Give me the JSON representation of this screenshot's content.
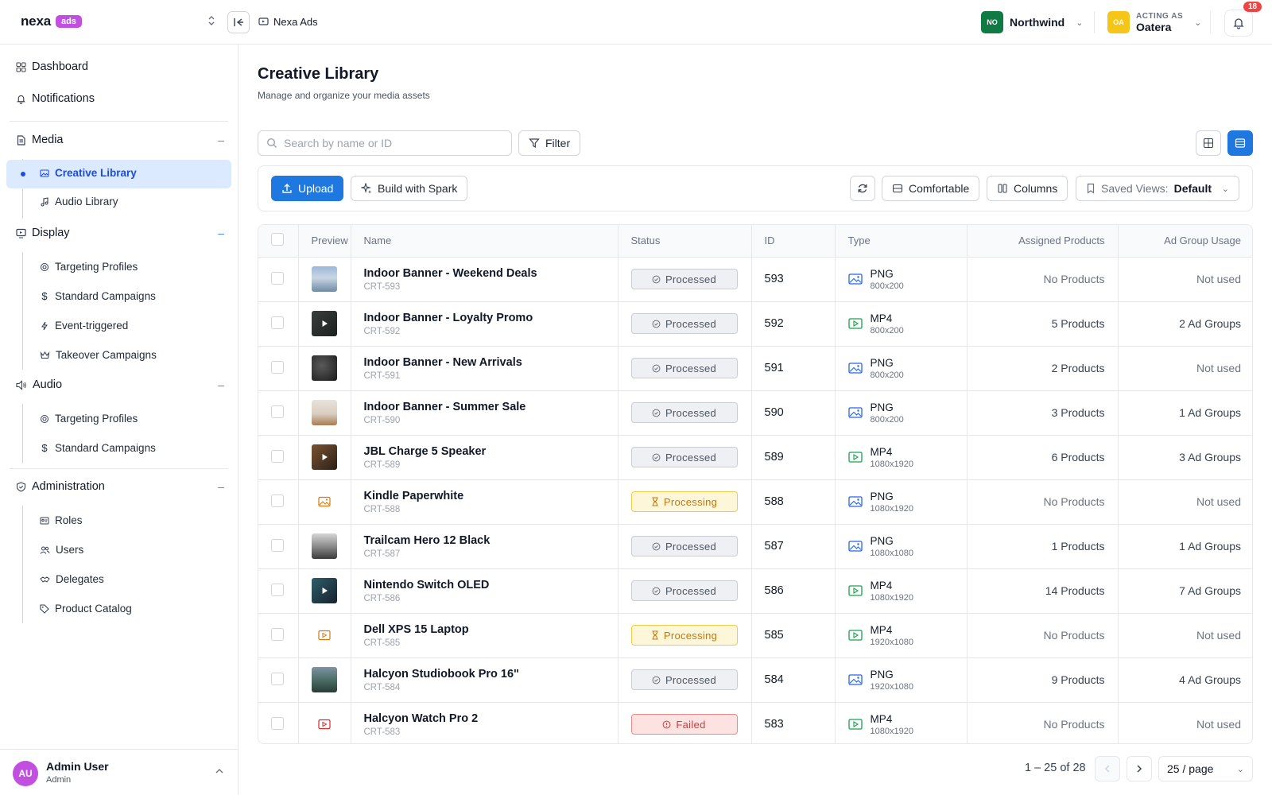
{
  "header": {
    "brand_name": "nexa",
    "brand_badge": "ads",
    "breadcrumb": "Nexa Ads",
    "org": {
      "initials": "NO",
      "name": "Northwind",
      "color": "#0f7a43"
    },
    "acting_as": {
      "label": "ACTING AS",
      "initials": "OA",
      "name": "Oatera",
      "color": "#f5c518"
    },
    "notifications_count": "18"
  },
  "sidebar": {
    "top_items": [
      {
        "label": "Dashboard",
        "icon": "grid-icon"
      },
      {
        "label": "Notifications",
        "icon": "bell-icon"
      }
    ],
    "sections": [
      {
        "label": "Media",
        "icon": "document-icon",
        "collapse": "–",
        "items": [
          {
            "label": "Creative Library",
            "icon": "image-icon",
            "active": true
          },
          {
            "label": "Audio Library",
            "icon": "music-note-icon"
          }
        ]
      },
      {
        "label": "Display",
        "icon": "monitor-icon",
        "collapse": "–",
        "items": [
          {
            "label": "Targeting Profiles",
            "icon": "target-icon"
          },
          {
            "label": "Standard Campaigns",
            "icon": "dollar-icon"
          },
          {
            "label": "Event-triggered",
            "icon": "lightning-icon"
          },
          {
            "label": "Takeover Campaigns",
            "icon": "crown-icon"
          }
        ]
      },
      {
        "label": "Audio",
        "icon": "speaker-icon",
        "collapse": "–",
        "items": [
          {
            "label": "Targeting Profiles",
            "icon": "target-icon"
          },
          {
            "label": "Standard Campaigns",
            "icon": "dollar-icon"
          }
        ]
      },
      {
        "label": "Administration",
        "icon": "shield-check-icon",
        "collapse": "–",
        "items": [
          {
            "label": "Roles",
            "icon": "id-card-icon"
          },
          {
            "label": "Users",
            "icon": "users-icon"
          },
          {
            "label": "Delegates",
            "icon": "handshake-icon"
          },
          {
            "label": "Product Catalog",
            "icon": "tag-icon"
          }
        ]
      }
    ],
    "user": {
      "initials": "AU",
      "name": "Admin User",
      "role": "Admin"
    }
  },
  "main": {
    "title": "Creative Library",
    "subtitle": "Manage and organize your media assets",
    "search_placeholder": "Search by name or ID",
    "filter_label": "Filter",
    "upload_label": "Upload",
    "spark_label": "Build with Spark",
    "density_label": "Comfortable",
    "columns_label": "Columns",
    "saved_views_label": "Saved Views:",
    "saved_views_value": "Default"
  },
  "table": {
    "columns": [
      "Preview",
      "Name",
      "Status",
      "ID",
      "Type",
      "Assigned Products",
      "Ad Group Usage"
    ],
    "rows": [
      {
        "name": "Indoor Banner - Weekend Deals",
        "code": "CRT-593",
        "status": "Processed",
        "id": "593",
        "type": "PNG",
        "dims": "800x200",
        "products": "No Products",
        "usage": "Not used",
        "thumb": "landscape"
      },
      {
        "name": "Indoor Banner - Loyalty Promo",
        "code": "CRT-592",
        "status": "Processed",
        "id": "592",
        "type": "MP4",
        "dims": "800x200",
        "products": "5 Products",
        "usage": "2 Ad Groups",
        "thumb": "video-dark"
      },
      {
        "name": "Indoor Banner - New Arrivals",
        "code": "CRT-591",
        "status": "Processed",
        "id": "591",
        "type": "PNG",
        "dims": "800x200",
        "products": "2 Products",
        "usage": "Not used",
        "thumb": "dark"
      },
      {
        "name": "Indoor Banner - Summer Sale",
        "code": "CRT-590",
        "status": "Processed",
        "id": "590",
        "type": "PNG",
        "dims": "800x200",
        "products": "3 Products",
        "usage": "1 Ad Groups",
        "thumb": "pier"
      },
      {
        "name": "JBL Charge 5 Speaker",
        "code": "CRT-589",
        "status": "Processed",
        "id": "589",
        "type": "MP4",
        "dims": "1080x1920",
        "products": "6 Products",
        "usage": "3 Ad Groups",
        "thumb": "video-brown"
      },
      {
        "name": "Kindle Paperwhite",
        "code": "CRT-588",
        "status": "Processing",
        "id": "588",
        "type": "PNG",
        "dims": "1080x1920",
        "products": "No Products",
        "usage": "Not used",
        "thumb": "placeholder-image"
      },
      {
        "name": "Trailcam Hero 12 Black",
        "code": "CRT-587",
        "status": "Processed",
        "id": "587",
        "type": "PNG",
        "dims": "1080x1080",
        "products": "1 Products",
        "usage": "1 Ad Groups",
        "thumb": "mountain"
      },
      {
        "name": "Nintendo Switch OLED",
        "code": "CRT-586",
        "status": "Processed",
        "id": "586",
        "type": "MP4",
        "dims": "1080x1920",
        "products": "14 Products",
        "usage": "7 Ad Groups",
        "thumb": "video-teal"
      },
      {
        "name": "Dell XPS 15 Laptop",
        "code": "CRT-585",
        "status": "Processing",
        "id": "585",
        "type": "MP4",
        "dims": "1920x1080",
        "products": "No Products",
        "usage": "Not used",
        "thumb": "placeholder-video"
      },
      {
        "name": "Halcyon Studiobook Pro 16\"",
        "code": "CRT-584",
        "status": "Processed",
        "id": "584",
        "type": "PNG",
        "dims": "1920x1080",
        "products": "9 Products",
        "usage": "4 Ad Groups",
        "thumb": "coast"
      },
      {
        "name": "Halcyon Watch Pro 2",
        "code": "CRT-583",
        "status": "Failed",
        "id": "583",
        "type": "MP4",
        "dims": "1080x1920",
        "products": "No Products",
        "usage": "Not used",
        "thumb": "failed-video"
      }
    ]
  },
  "pagination": {
    "range": "1 – 25 of 28",
    "per_page": "25 / page"
  }
}
